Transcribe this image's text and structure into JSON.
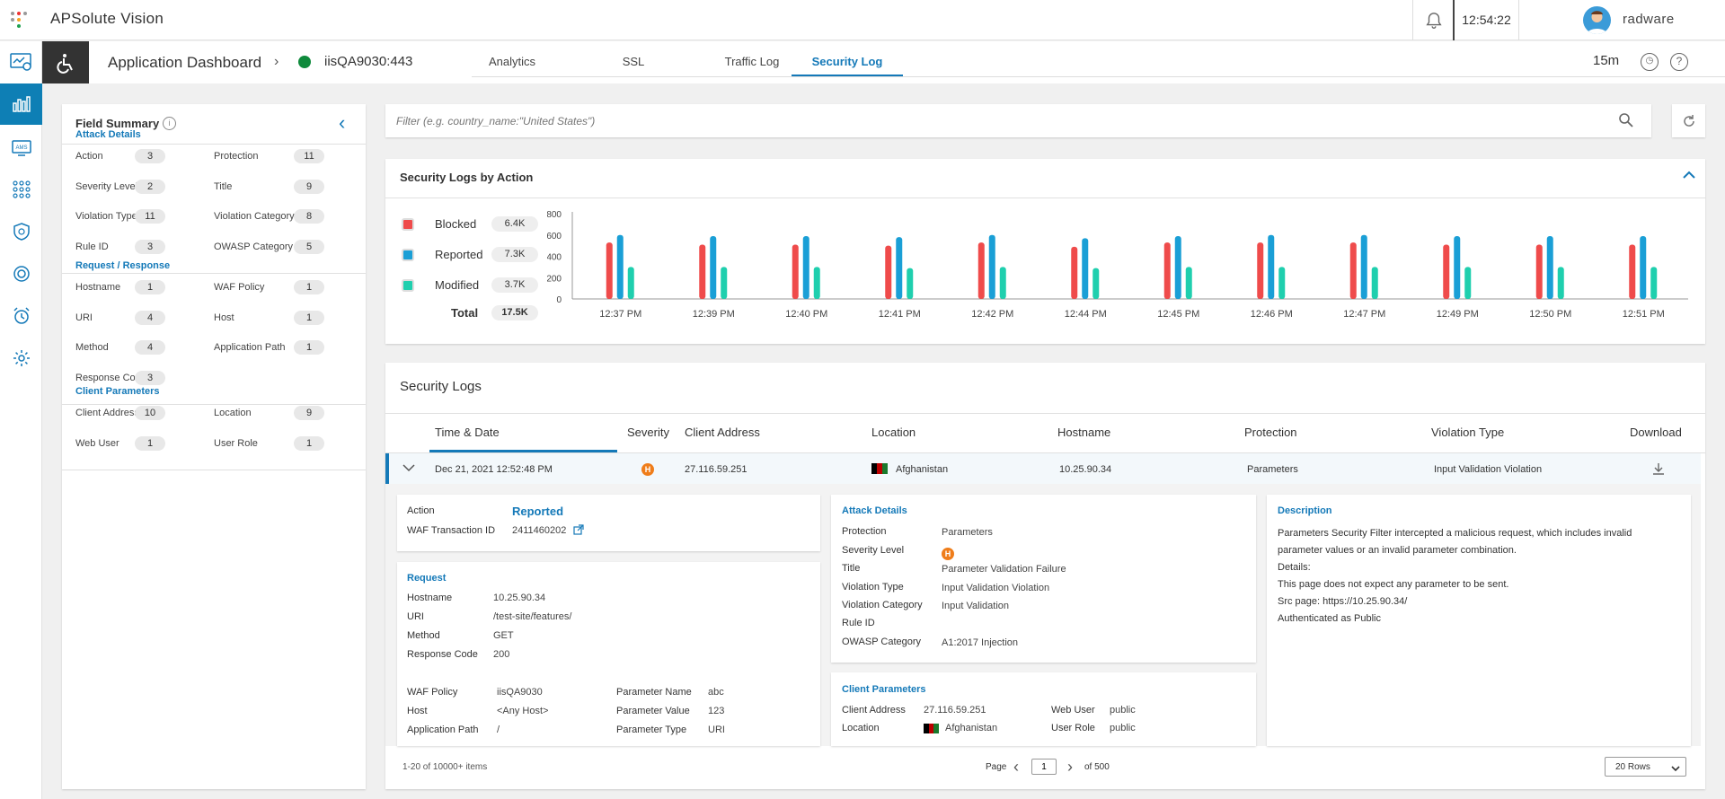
{
  "app": {
    "title": "APSolute Vision",
    "clock": "12:54:22",
    "user": "radware"
  },
  "header": {
    "breadcrumb": "Application Dashboard",
    "app_name": "iisQA9030:443",
    "time_range": "15m"
  },
  "tabs": [
    "Analytics",
    "SSL",
    "Traffic Log",
    "Security Log"
  ],
  "filter": {
    "placeholder": "Filter (e.g. country_name:\"United States\")"
  },
  "field_summary": {
    "title": "Field Summary",
    "sections": [
      {
        "title": "Attack Details",
        "items": [
          {
            "label": "Action",
            "count": "3"
          },
          {
            "label": "Protection",
            "count": "11"
          },
          {
            "label": "Severity Level",
            "count": "2"
          },
          {
            "label": "Title",
            "count": "9"
          },
          {
            "label": "Violation Type",
            "count": "11"
          },
          {
            "label": "Violation Category",
            "count": "8"
          },
          {
            "label": "Rule ID",
            "count": "3"
          },
          {
            "label": "OWASP Category",
            "count": "5"
          }
        ]
      },
      {
        "title": "Request / Response",
        "items": [
          {
            "label": "Hostname",
            "count": "1"
          },
          {
            "label": "WAF Policy",
            "count": "1"
          },
          {
            "label": "URI",
            "count": "4"
          },
          {
            "label": "Host",
            "count": "1"
          },
          {
            "label": "Method",
            "count": "4"
          },
          {
            "label": "Application Path",
            "count": "1"
          },
          {
            "label": "Response Code",
            "count": "3"
          }
        ]
      },
      {
        "title": "Client Parameters",
        "items": [
          {
            "label": "Client Address",
            "count": "10"
          },
          {
            "label": "Location",
            "count": "9"
          },
          {
            "label": "Web User",
            "count": "1"
          },
          {
            "label": "User Role",
            "count": "1"
          }
        ]
      }
    ]
  },
  "chart_section": {
    "title": "Security Logs by Action",
    "legend": [
      {
        "label": "Blocked",
        "value": "6.4K",
        "color": "#ef4b4b"
      },
      {
        "label": "Reported",
        "value": "7.3K",
        "color": "#1a9fd6"
      },
      {
        "label": "Modified",
        "value": "3.7K",
        "color": "#1fcfae"
      }
    ],
    "total_label": "Total",
    "total_value": "17.5K"
  },
  "chart_data": {
    "type": "bar",
    "categories": [
      "12:37 PM",
      "12:39 PM",
      "12:40 PM",
      "12:41 PM",
      "12:42 PM",
      "12:44 PM",
      "12:45 PM",
      "12:46 PM",
      "12:47 PM",
      "12:49 PM",
      "12:50 PM",
      "12:51 PM"
    ],
    "series": [
      {
        "name": "Blocked",
        "color": "#ef4b4b",
        "values": [
          530,
          510,
          510,
          500,
          530,
          490,
          530,
          530,
          530,
          510,
          510,
          510
        ]
      },
      {
        "name": "Reported",
        "color": "#1a9fd6",
        "values": [
          600,
          590,
          590,
          580,
          600,
          570,
          590,
          600,
          600,
          590,
          590,
          590
        ]
      },
      {
        "name": "Modified",
        "color": "#1fcfae",
        "values": [
          300,
          300,
          300,
          290,
          300,
          290,
          300,
          300,
          300,
          300,
          300,
          300
        ]
      }
    ],
    "yticks": [
      "800",
      "600",
      "400",
      "200",
      "0"
    ],
    "ylim": [
      0,
      800
    ]
  },
  "logs": {
    "title": "Security Logs",
    "columns": [
      "Time & Date",
      "Severity",
      "Client Address",
      "Location",
      "Hostname",
      "Protection",
      "Violation Type",
      "Download"
    ],
    "row": {
      "time": "Dec 21, 2021 12:52:48 PM",
      "severity": "H",
      "client": "27.116.59.251",
      "location": "Afghanistan",
      "hostname": "10.25.90.34",
      "protection": "Parameters",
      "violation": "Input Validation Violation"
    },
    "action_card": {
      "action_label": "Action",
      "action_value": "Reported",
      "waf_label": "WAF Transaction ID",
      "waf_value": "2411460202"
    },
    "request_card": {
      "title": "Request",
      "rows": [
        {
          "k": "Hostname",
          "v": "10.25.90.34"
        },
        {
          "k": "URI",
          "v": "/test-site/features/"
        },
        {
          "k": "Method",
          "v": "GET"
        },
        {
          "k": "Response Code",
          "v": "200"
        }
      ],
      "extra_left": [
        {
          "k": "WAF Policy",
          "v": "iisQA9030"
        },
        {
          "k": "Host",
          "v": "<Any Host>"
        },
        {
          "k": "Application Path",
          "v": "/"
        }
      ],
      "extra_right": [
        {
          "k": "Parameter Name",
          "v": "abc"
        },
        {
          "k": "Parameter Value",
          "v": "123"
        },
        {
          "k": "Parameter Type",
          "v": "URI"
        }
      ]
    },
    "attack_card": {
      "title": "Attack Details",
      "rows": [
        {
          "k": "Protection",
          "v": "Parameters"
        },
        {
          "k": "Severity Level",
          "v": "H"
        },
        {
          "k": "Title",
          "v": "Parameter Validation Failure"
        },
        {
          "k": "Violation Type",
          "v": "Input Validation Violation"
        },
        {
          "k": "Violation Category",
          "v": "Input Validation"
        },
        {
          "k": "Rule ID",
          "v": ""
        },
        {
          "k": "OWASP Category",
          "v": "A1:2017 Injection"
        }
      ]
    },
    "client_card": {
      "title": "Client Parameters",
      "client_label": "Client Address",
      "client_value": "27.116.59.251",
      "location_label": "Location",
      "location_value": "Afghanistan",
      "webuser_label": "Web User",
      "webuser_value": "public",
      "role_label": "User Role",
      "role_value": "public"
    },
    "description": {
      "title": "Description",
      "lines": [
        "Parameters Security Filter intercepted a malicious request, which includes invalid",
        "parameter values or an invalid parameter combination.",
        "Details:",
        "This page does not expect any parameter to be sent.",
        "Src page: https://10.25.90.34/",
        "Authenticated as Public"
      ]
    },
    "footer": {
      "count": "1-20 of 10000+ items",
      "page_label": "Page",
      "page_value": "1",
      "of_label": "of 500",
      "rows_select": "20 Rows"
    }
  }
}
